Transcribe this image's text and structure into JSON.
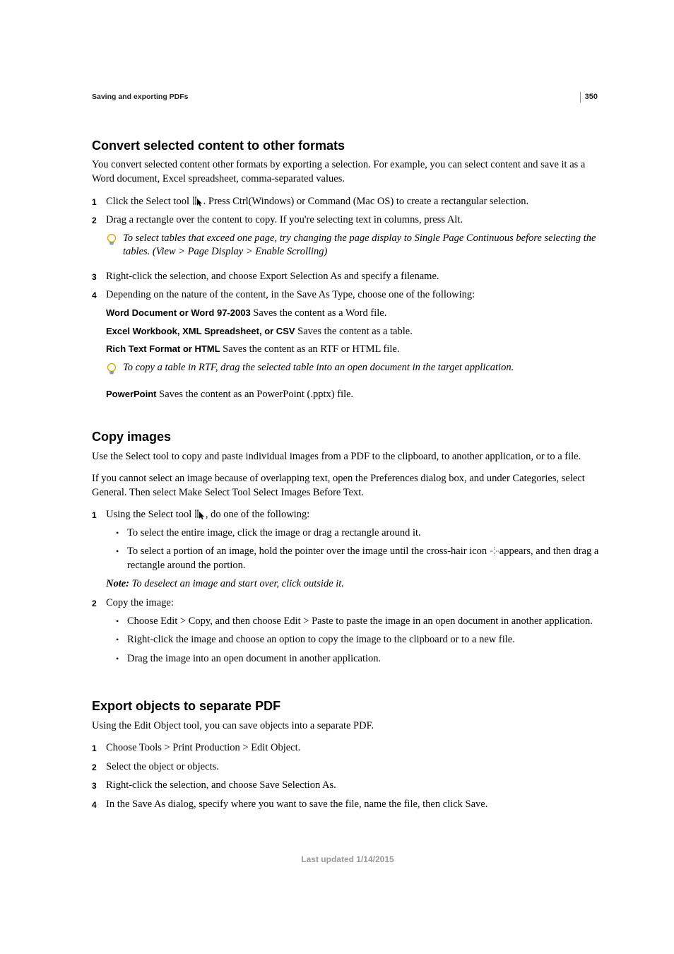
{
  "page_number": "350",
  "running_header": "Saving and exporting PDFs",
  "footer": "Last updated 1/14/2015",
  "s1": {
    "title": "Convert selected content to other formats",
    "intro": "You convert selected content other formats by exporting a selection. For example, you can select content and save it as a Word document, Excel spreadsheet, comma-separated values.",
    "step1_a": "Click the Select tool ",
    "step1_b": ". Press Ctrl(Windows) or Command (Mac OS) to create a rectangular selection.",
    "step2": "Drag a rectangle over the content to copy. If you're selecting text in columns, press Alt.",
    "tip1": "To select tables that exceed one page, try changing the page display to Single Page Continuous before selecting the tables. (View > Page Display > Enable Scrolling)",
    "step3": "Right-click the selection, and choose Export Selection As and specify a filename.",
    "step4": "Depending on the nature of the content, in the Save As Type, choose one of the following:",
    "opt1_term": "Word Document or Word 97-2003",
    "opt1_desc": " Saves the content as a Word file.",
    "opt2_term": "Excel Workbook, XML Spreadsheet, or CSV",
    "opt2_desc": " Saves the content as a table.",
    "opt3_term": "Rich Text Format or HTML",
    "opt3_desc": " Saves the content as an RTF or HTML file.",
    "tip2": "To copy a table in RTF, drag the selected table into an open document in the target application.",
    "opt4_term": "PowerPoint",
    "opt4_desc": " Saves the content as an PowerPoint (.pptx) file."
  },
  "s2": {
    "title": "Copy images",
    "p1": "Use the Select tool to copy and paste individual images from a PDF to the clipboard, to another application, or to a file.",
    "p2": "If you cannot select an image because of overlapping text, open the Preferences dialog box, and under Categories, select General. Then select Make Select Tool Select Images Before Text.",
    "step1_a": "Using the Select tool ",
    "step1_b": ", do one of the following:",
    "b1": "To select the entire image, click the image or drag a rectangle around it.",
    "b2_a": "To select a portion of an image, hold the pointer over the image until the cross-hair icon ",
    "b2_b": "appears, and then drag a rectangle around the portion.",
    "note_label": "Note: ",
    "note_text": "To deselect an image and start over, click outside it.",
    "step2": "Copy the image:",
    "b3": "Choose Edit > Copy, and then choose Edit > Paste to paste the image in an open document in another application.",
    "b4": "Right-click the image and choose an option to copy the image to the clipboard or to a new file.",
    "b5": "Drag the image into an open document in another application."
  },
  "s3": {
    "title": "Export objects to separate PDF",
    "p1": "Using the Edit Object tool, you can save objects into a separate PDF.",
    "step1": "Choose Tools > Print Production > Edit Object.",
    "step2": "Select the object or objects.",
    "step3": "Right-click the selection, and choose Save Selection As.",
    "step4": "In the Save As dialog, specify where you want to save the file, name the file, then click Save."
  },
  "numbers": {
    "n1": "1",
    "n2": "2",
    "n3": "3",
    "n4": "4"
  }
}
